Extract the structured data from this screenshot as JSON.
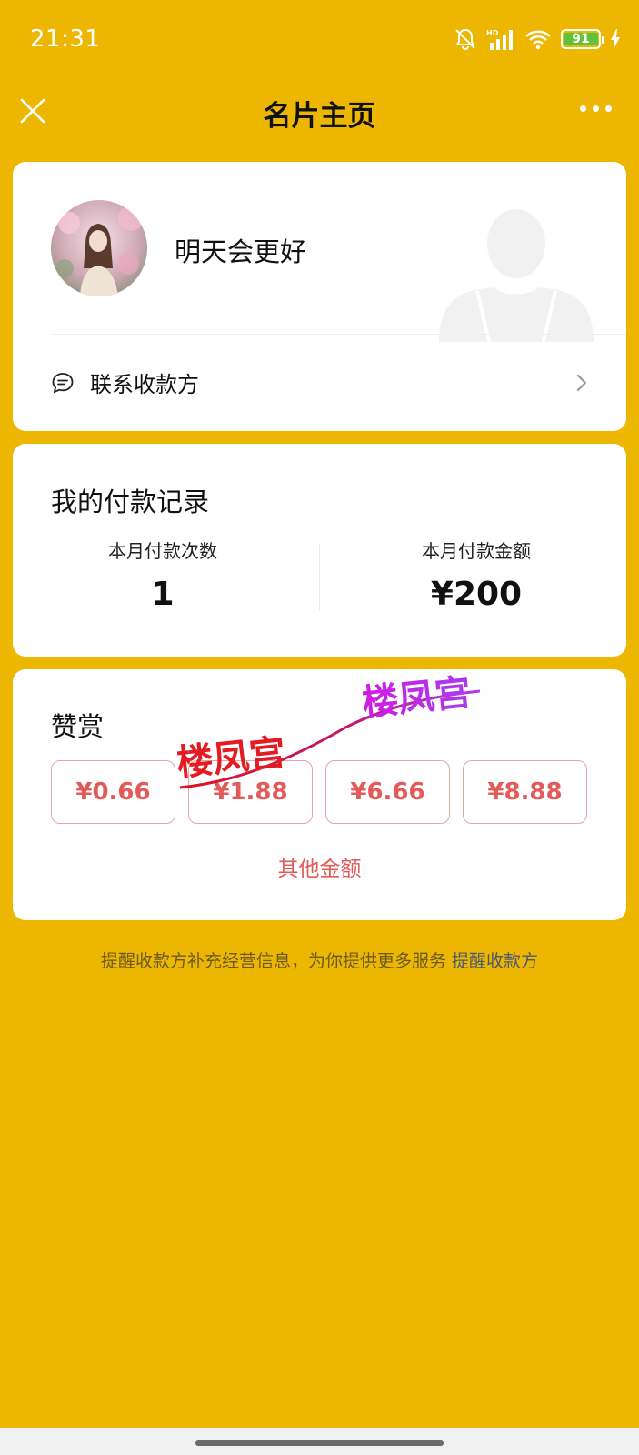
{
  "status_bar": {
    "time": "21:31",
    "battery_level": "91",
    "icons": [
      "bell-muted-icon",
      "hd-signal-icon",
      "wifi-icon",
      "battery-icon",
      "charging-bolt-icon"
    ]
  },
  "nav": {
    "title": "名片主页",
    "close_icon": "close-icon",
    "more_icon": "more-icon"
  },
  "profile": {
    "name": "明天会更好",
    "contact_label": "联系收款方"
  },
  "payments": {
    "title": "我的付款记录",
    "count_label": "本月付款次数",
    "count_value": "1",
    "amount_label": "本月付款金额",
    "amount_value": "¥200"
  },
  "tip": {
    "title": "赞赏",
    "amounts": [
      "¥0.66",
      "¥1.88",
      "¥6.66",
      "¥8.88"
    ],
    "other_label": "其他金额"
  },
  "watermark": {
    "text_1": "楼凤宫",
    "text_2": "楼凤宫"
  },
  "footer": {
    "note": "提醒收款方补充经营信息，为你提供更多服务",
    "link": "提醒收款方"
  },
  "colors": {
    "background": "#EDB600",
    "accent_red": "#e25a5a",
    "card": "#ffffff"
  }
}
